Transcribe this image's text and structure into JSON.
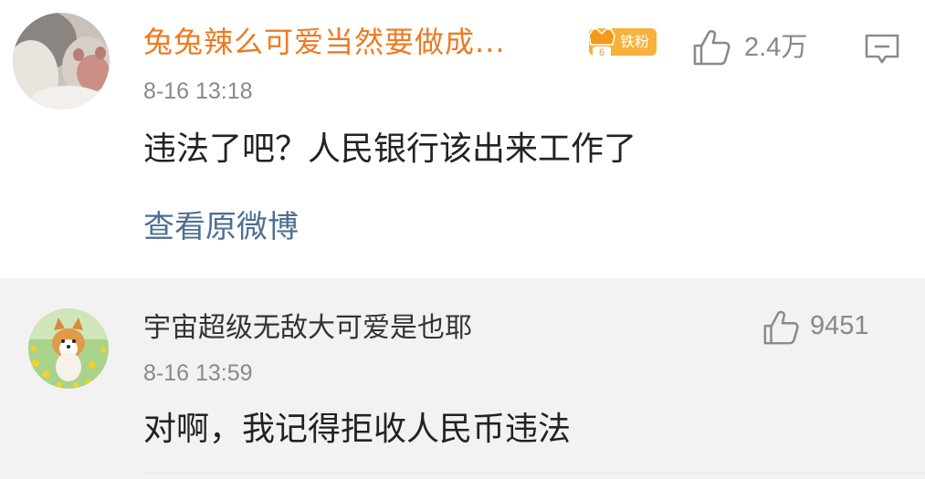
{
  "comment": {
    "username": "兔兔辣么可爱当然要做成...",
    "badge_label": "铁粉",
    "badge_level": "6",
    "timestamp": "8-16 13:18",
    "text": "违法了吧？人民银行该出来工作了",
    "like_count": "2.4万",
    "view_original_label": "查看原微博",
    "colors": {
      "username": "#ee7a20",
      "badge": "#f7b23b",
      "link": "#4f6f92"
    }
  },
  "reply": {
    "username": "宇宙超级无敌大可爱是也耶",
    "timestamp": "8-16 13:59",
    "text": "对啊，我记得拒收人民币违法",
    "like_count": "9451",
    "colors": {
      "username": "#333333",
      "background": "#f2f2f2"
    }
  }
}
